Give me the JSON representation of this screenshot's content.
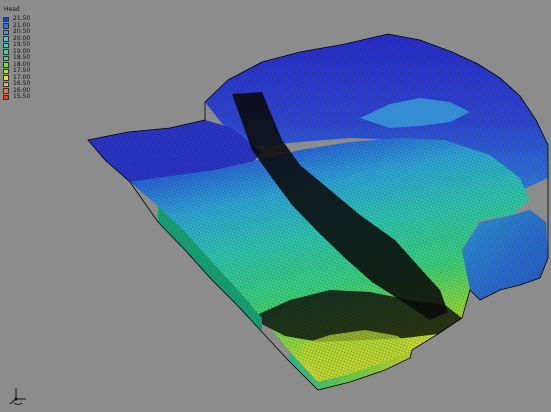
{
  "legend": {
    "title": "Head",
    "entries": [
      {
        "label": "21.50",
        "color": "#1f3fe6"
      },
      {
        "label": "21.00",
        "color": "#2c6ef0"
      },
      {
        "label": "20.50",
        "color": "#32a0f2"
      },
      {
        "label": "20.00",
        "color": "#32c7e6"
      },
      {
        "label": "19.50",
        "color": "#2fd9c0"
      },
      {
        "label": "19.00",
        "color": "#34dc95"
      },
      {
        "label": "18.50",
        "color": "#3fdc62"
      },
      {
        "label": "18.00",
        "color": "#72de34"
      },
      {
        "label": "17.50",
        "color": "#b5e12e"
      },
      {
        "label": "17.00",
        "color": "#e8e02e"
      },
      {
        "label": "16.50",
        "color": "#f2b42a"
      },
      {
        "label": "16.00",
        "color": "#f07a22"
      },
      {
        "label": "15.50",
        "color": "#e8401c"
      }
    ]
  },
  "viewport": {
    "background": "#8c8c8c",
    "mesh_color": "#000000",
    "axis_icon": "axis-triad-icon"
  }
}
